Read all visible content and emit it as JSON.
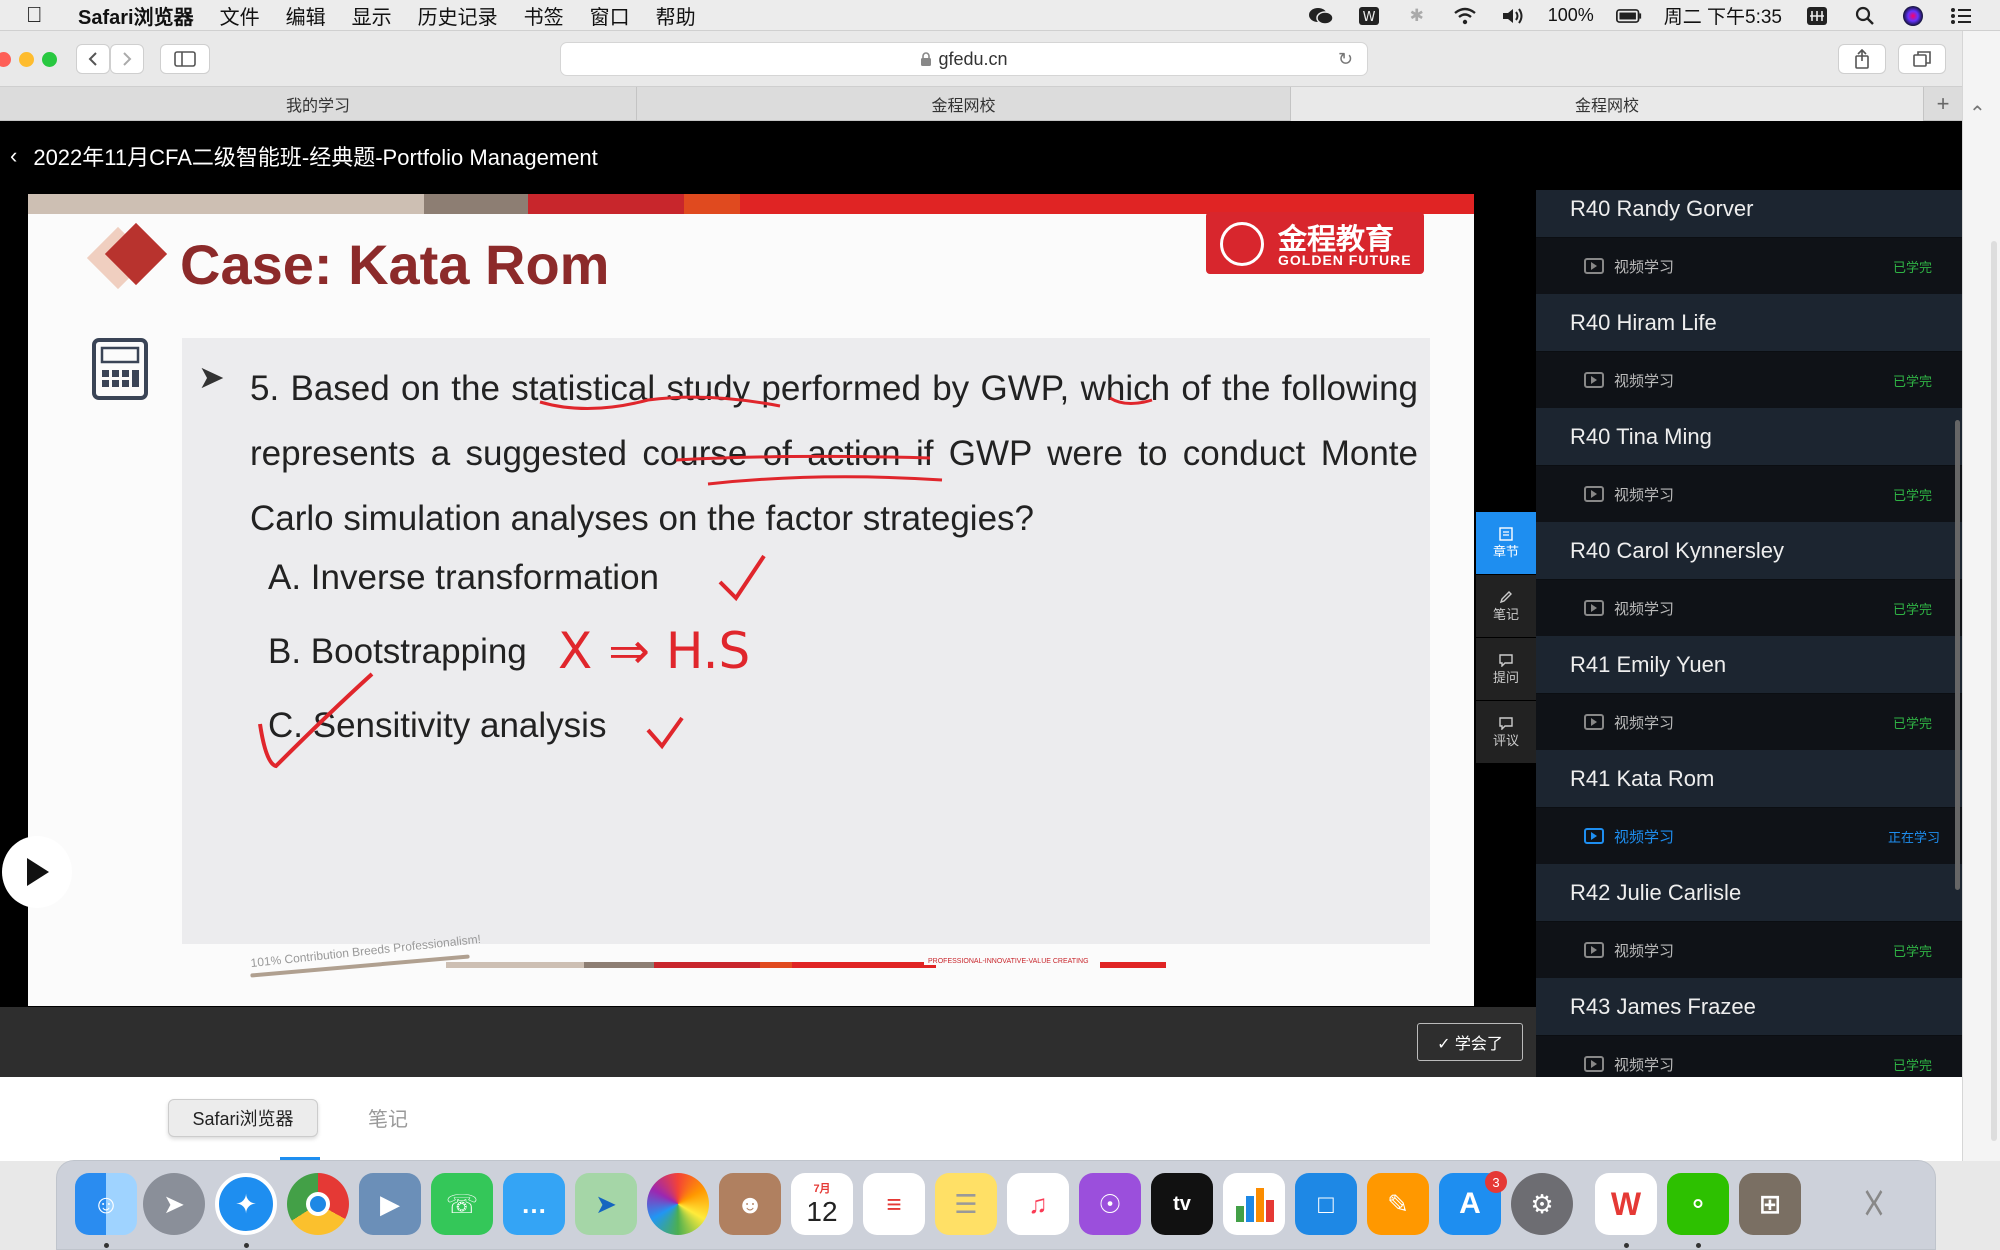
{
  "menubar": {
    "app_name": "Safari浏览器",
    "items": [
      "文件",
      "编辑",
      "显示",
      "历史记录",
      "书签",
      "窗口",
      "帮助"
    ],
    "battery": "100%",
    "clock": "周二 下午5:35"
  },
  "browser": {
    "url": "gfedu.cn",
    "tabs": [
      "我的学习",
      "金程网校",
      "金程网校"
    ]
  },
  "page": {
    "title": "2022年11月CFA二级智能班-经典题-Portfolio Management"
  },
  "slide": {
    "title": "Case: Kata Rom",
    "brand_cn": "金程教育",
    "brand_en": "GOLDEN FUTURE",
    "question": "5. Based on the statistical study performed by GWP, which of the following represents a suggested course of action if GWP were to conduct Monte Carlo simulation analyses on the factor strategies?",
    "options": [
      "A. Inverse transformation",
      "B. Bootstrapping",
      "C. Sensitivity analysis"
    ],
    "annotation_b": "X ⇒ H.S",
    "slogan": "101% Contribution Breeds Professionalism!",
    "footer_text": "PROFESSIONAL-INNOVATIVE-VALUE CREATING"
  },
  "side_tabs": [
    "章节",
    "笔记",
    "提问",
    "评议"
  ],
  "learned_button": "✓ 学会了",
  "chapters": [
    {
      "title": "R40 Randy Gorver",
      "lesson": "视频学习",
      "status": "已学完"
    },
    {
      "title": "R40 Hiram Life",
      "lesson": "视频学习",
      "status": "已学完"
    },
    {
      "title": "R40 Tina Ming",
      "lesson": "视频学习",
      "status": "已学完"
    },
    {
      "title": "R40 Carol Kynnersley",
      "lesson": "视频学习",
      "status": "已学完"
    },
    {
      "title": "R41 Emily Yuen",
      "lesson": "视频学习",
      "status": "已学完"
    },
    {
      "title": "R41 Kata Rom",
      "lesson": "视频学习",
      "status": "正在学习"
    },
    {
      "title": "R42 Julie Carlisle",
      "lesson": "视频学习",
      "status": "已学完"
    },
    {
      "title": "R43 James Frazee",
      "lesson": "视频学习",
      "status": "已学完"
    }
  ],
  "lower": {
    "tooltip": "Safari浏览器",
    "notes_tab": "笔记"
  },
  "dock": {
    "calendar_month": "7月",
    "calendar_day": "12",
    "appstore_badge": "3"
  },
  "colors": {
    "accent_blue": "#1e8ef0",
    "done_green": "#2fb344",
    "brand_red": "#d8262d",
    "title_red": "#8c2a2a"
  }
}
